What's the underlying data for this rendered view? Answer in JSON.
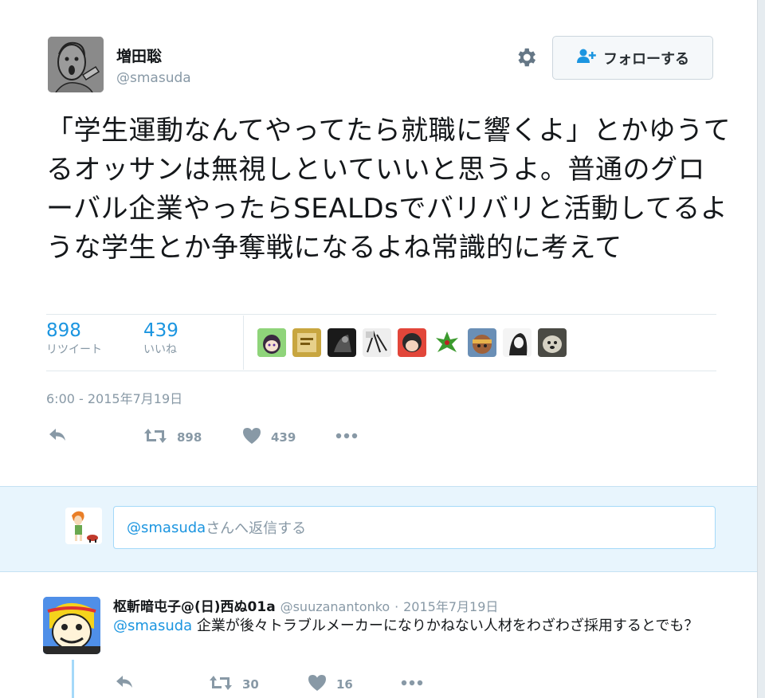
{
  "tweet": {
    "author_name": "増田聡",
    "author_handle": "@smasuda",
    "follow_label": "フォローする",
    "text": "「学生運動なんてやってたら就職に響くよ」とかゆうてるオッサンは無視しといていいと思うよ。普通のグローバル企業やったらSEALDsでバリバリと活動してるような学生とか争奪戦になるよね常識的に考えて",
    "retweet_count": "898",
    "retweet_label": "リツイート",
    "like_count": "439",
    "like_label": "いいね",
    "timestamp": "6:00 - 2015年7月19日",
    "actions": {
      "retweet_count": "898",
      "like_count": "439"
    }
  },
  "reply_box": {
    "mention": "@smasuda",
    "placeholder_rest": "さんへ返信する"
  },
  "reply": {
    "author_name": "枢斬暗屯子@(日)西ぬ01a",
    "author_handle": "@suuzanantonko",
    "separator": "·",
    "date": "2015年7月19日",
    "mention": "@smasuda",
    "text": " 企業が後々トラブルメーカーになりかねない人材をわざわざ採用するとでも？",
    "retweet_count": "30",
    "like_count": "16"
  },
  "colors": {
    "accent": "#1b95e0",
    "muted": "#8899a6",
    "reply_bg": "#e8f5fd"
  }
}
